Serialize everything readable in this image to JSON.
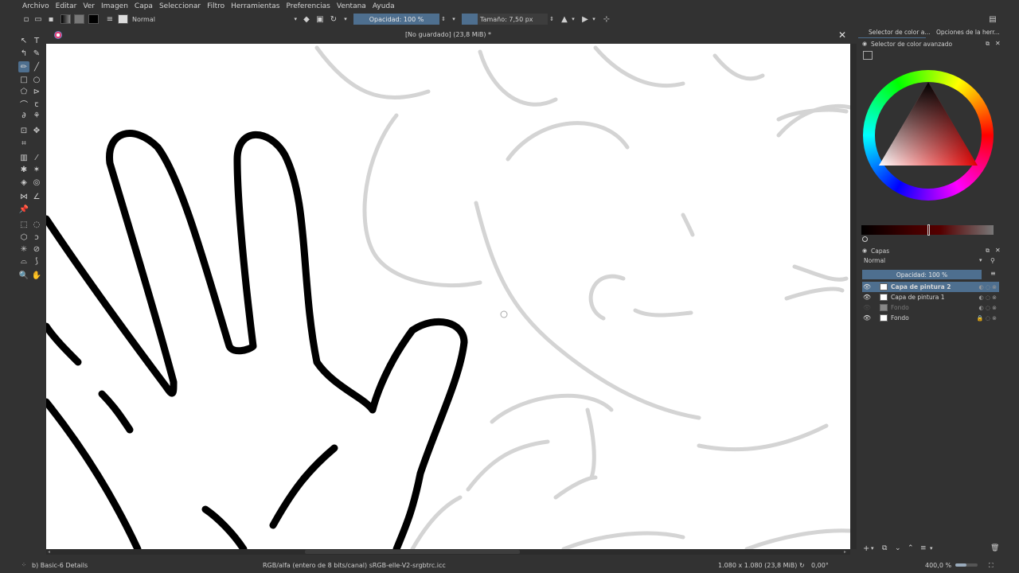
{
  "menu": [
    "Archivo",
    "Editar",
    "Ver",
    "Imagen",
    "Capa",
    "Seleccionar",
    "Filtro",
    "Herramientas",
    "Preferencias",
    "Ventana",
    "Ayuda"
  ],
  "toolbar": {
    "blend_mode": "Normal",
    "opacity_label": "Opacidad: 100 %",
    "size_label": "Tamaño: 7,50 px"
  },
  "document": {
    "title": "[No guardado]  (23,8 MiB) *"
  },
  "dock": {
    "tab_color": "Selector de color a...",
    "tab_tool": "Opciones de la herr...",
    "color_panel_title": "Selector de color avanzado",
    "layers_title": "Capas",
    "layers_blend": "Normal",
    "layers_opacity": "Opacidad:  100 %",
    "layers": [
      {
        "name": "Capa de pintura 2",
        "selected": true,
        "visible": true
      },
      {
        "name": "Capa de pintura 1",
        "selected": false,
        "visible": true
      },
      {
        "name": "Fondo",
        "selected": false,
        "visible": false
      },
      {
        "name": "Fondo",
        "selected": false,
        "visible": true,
        "locked": true
      }
    ]
  },
  "status": {
    "brush": "b) Basic-6 Details",
    "color_space": "RGB/alfa (entero de 8 bits/canal)  sRGB-elle-V2-srgbtrc.icc",
    "dimensions": "1.080 x 1.080 (23,8 MiB)",
    "rotation": "0,00°",
    "zoom": "400,0 %"
  },
  "colors": {
    "accent": "#4e6f8f",
    "background": "#323232",
    "canvas": "#ffffff"
  }
}
